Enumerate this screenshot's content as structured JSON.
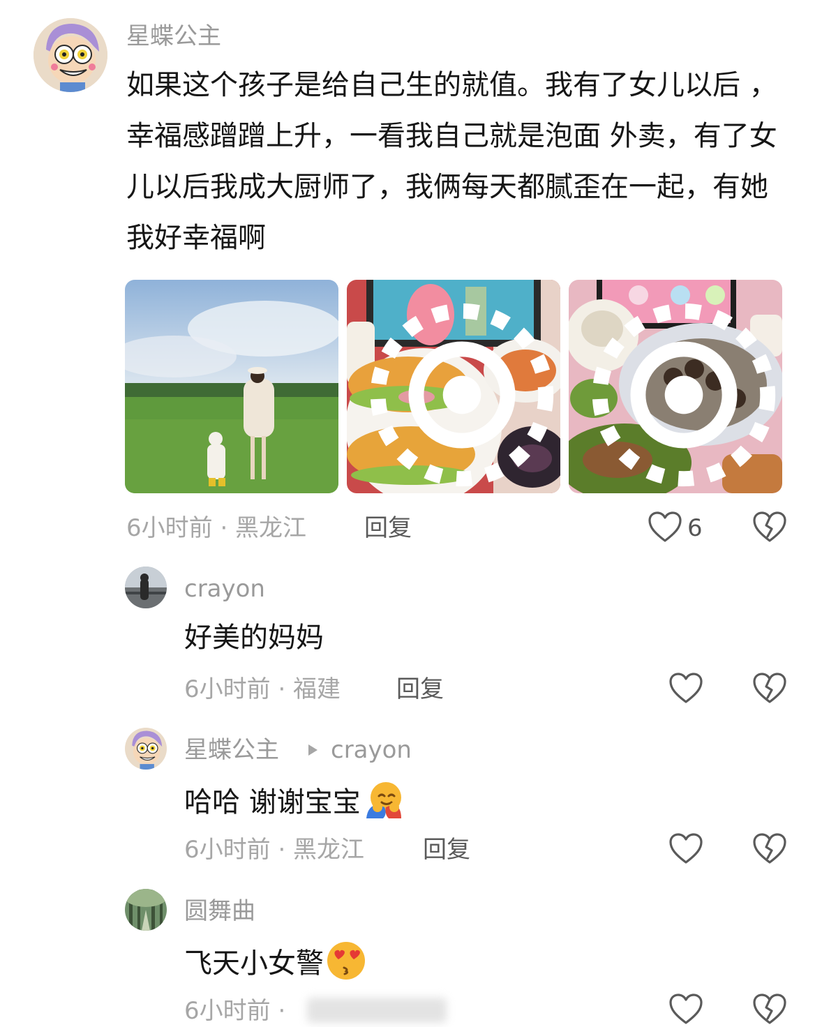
{
  "main_comment": {
    "username": "星蝶公主",
    "text": "如果这个孩子是给自己生的就值。我有了女儿以后 ，幸福感蹭蹭上升，一看我自己就是泡面 外卖，有了女儿以后我成大厨师了，我俩每天都腻歪在一起，有她我好幸福啊",
    "time_location": "6小时前 · 黑龙江",
    "reply_label": "回复",
    "like_count": "6",
    "icons": [
      "heart-outline-icon",
      "broken-heart-icon",
      "live-photo-icon"
    ]
  },
  "replies": [
    {
      "username": "crayon",
      "reply_to": "",
      "text": "好美的妈妈",
      "time_location": "6小时前 · 福建",
      "reply_label": "回复"
    },
    {
      "username": "星蝶公主",
      "reply_to": "crayon",
      "text": "哈哈 谢谢宝宝",
      "emoji": "hugging-face-emoji",
      "time_location": "6小时前 · 黑龙江",
      "reply_label": "回复"
    },
    {
      "username": "圆舞曲",
      "reply_to": "",
      "text": "飞天小女警",
      "emoji": "kissing-heart-eyes-emoji",
      "time_location": "6小时前 ·",
      "reply_label": ""
    }
  ],
  "colors": {
    "text": "#161616",
    "meta": "#a6a6a6",
    "username": "#9a9a9a",
    "reply": "#5a5a5a"
  }
}
